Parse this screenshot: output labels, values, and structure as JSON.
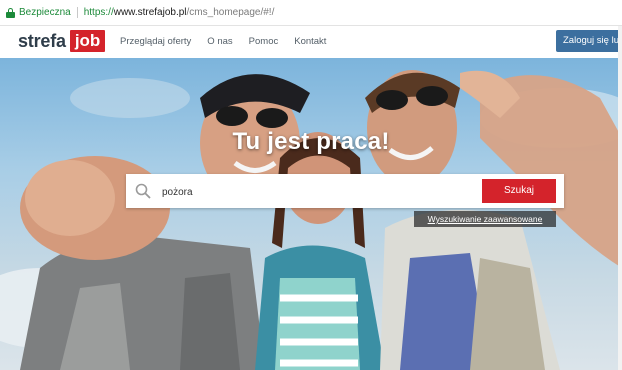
{
  "browser": {
    "secure_label": "Bezpieczna",
    "url_scheme": "https://",
    "url_host": "www.strefajob.pl",
    "url_path": "/cms_homepage/#!/"
  },
  "header": {
    "logo_part1": "strefa",
    "logo_part2": "job",
    "nav": [
      "Przeglądaj oferty",
      "O nas",
      "Pomoc",
      "Kontakt"
    ],
    "login_label": "Zaloguj się lub z"
  },
  "hero": {
    "title": "Tu jest praca!",
    "search_value": "pożora",
    "search_button": "Szukaj",
    "advanced_link": "Wyszukiwanie zaawansowane"
  },
  "colors": {
    "brand_red": "#d4232b",
    "brand_blue": "#3c6f9f",
    "secure_green": "#1c8a3a"
  }
}
